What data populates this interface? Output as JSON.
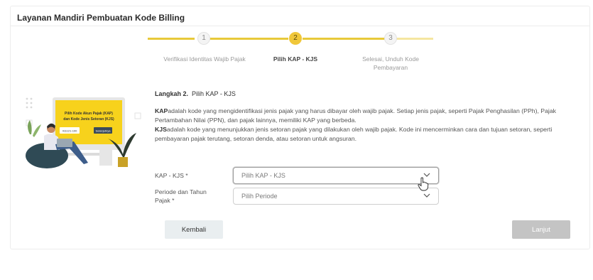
{
  "header": {
    "title": "Layanan Mandiri Pembuatan Kode Billing"
  },
  "stepper": {
    "steps": [
      {
        "number": "1",
        "label": "Verifikasi Identitas Wajib Pajak"
      },
      {
        "number": "2",
        "label": "Pilih KAP - KJS"
      },
      {
        "number": "3",
        "label": "Selesai, Unduh Kode Pembayaran"
      }
    ],
    "active_step": 2,
    "colors": {
      "active": "#f0c73a",
      "line": "#e8c93a"
    }
  },
  "illustration": {
    "screen_line1": "Pilih Kode Akun Pajak (KAP)",
    "screen_line2": "dan Kode Jenis Setoran (KJS)",
    "chip_left": "411121-100",
    "chip_right": "Selanjutnya"
  },
  "content": {
    "step_prefix": "Langkah 2.",
    "step_title": "Pilih KAP - KJS",
    "kap_term": "KAP",
    "kap_desc": "adalah kode yang mengidentifikasi jenis pajak yang harus dibayar oleh wajib pajak. Setiap jenis pajak, seperti Pajak Penghasilan (PPh), Pajak Pertambahan Nilai (PPN), dan pajak lainnya, memiliki KAP yang berbeda.",
    "kjs_term": "KJS",
    "kjs_desc": "adalah kode yang menunjukkan jenis setoran pajak yang dilakukan oleh wajib pajak. Kode ini mencerminkan cara dan tujuan setoran, seperti pembayaran pajak terutang, setoran denda, atau setoran untuk angsuran."
  },
  "form": {
    "kap_kjs_label": "KAP - KJS *",
    "kap_kjs_value": "Pilih KAP - KJS",
    "periode_label": "Periode dan Tahun Pajak *",
    "periode_value": "Pilih Periode"
  },
  "buttons": {
    "back": "Kembali",
    "next": "Lanjut"
  }
}
